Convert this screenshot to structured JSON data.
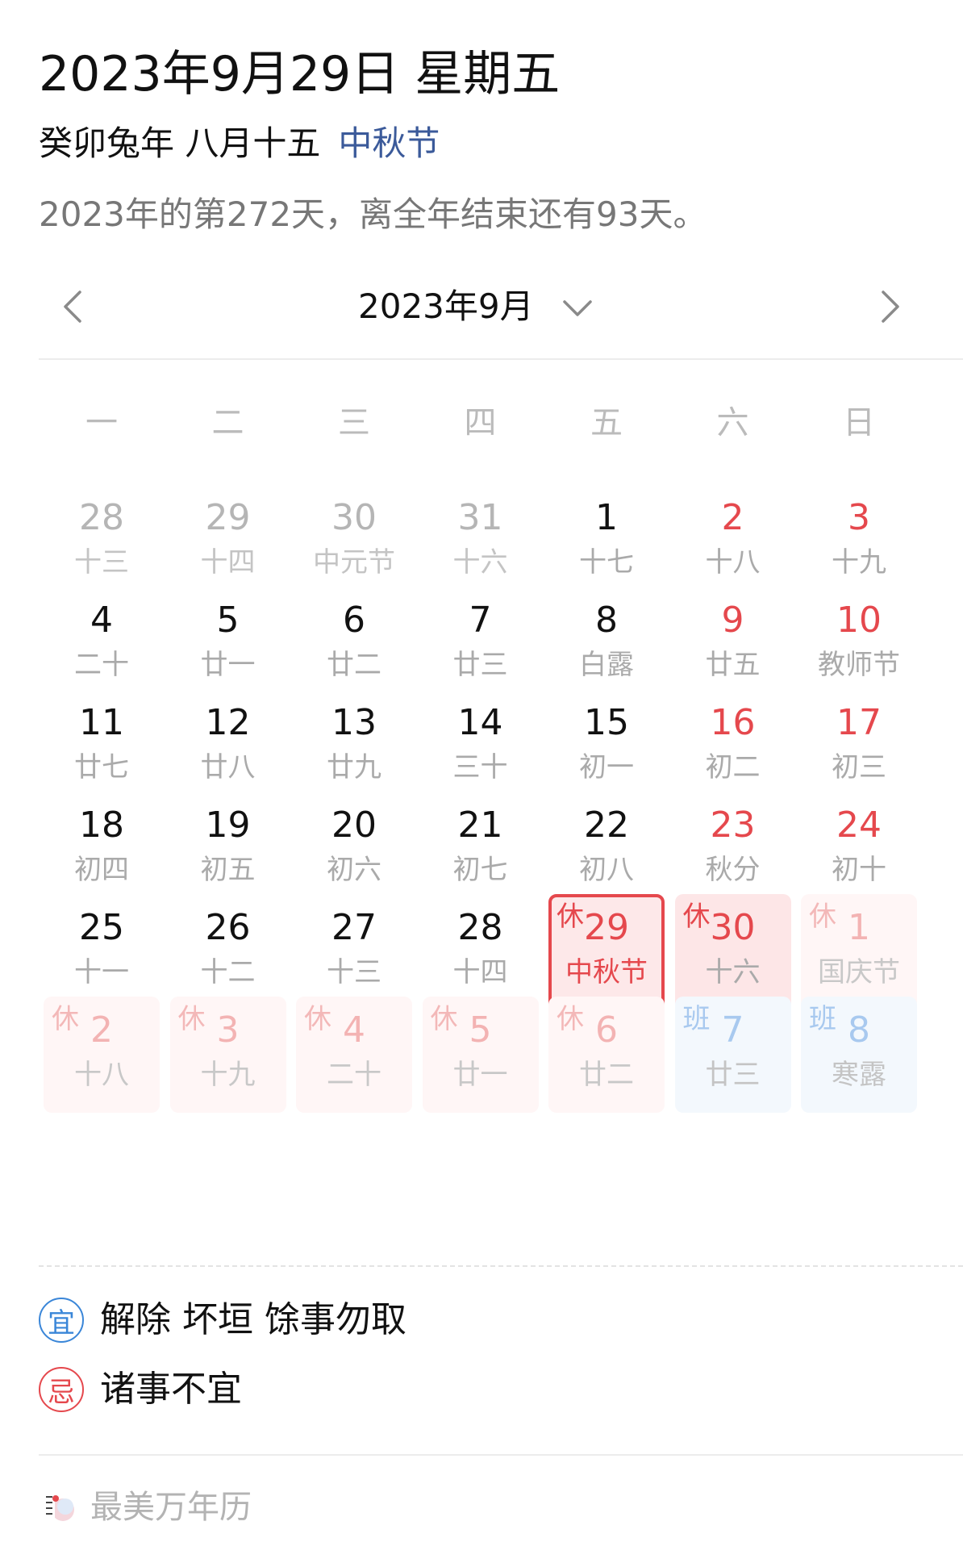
{
  "header": {
    "date_title": "2023年9月29日 星期五",
    "lunar_year": "癸卯兔年 八月十五",
    "festival": "中秋节",
    "year_progress": "2023年的第272天，离全年结束还有93天。"
  },
  "month_nav": {
    "prev_icon": "chevron-left-icon",
    "label": "2023年9月",
    "dropdown_icon": "chevron-down-icon",
    "next_icon": "chevron-right-icon"
  },
  "weekdays": [
    "一",
    "二",
    "三",
    "四",
    "五",
    "六",
    "日"
  ],
  "calendar": {
    "rows": [
      [
        {
          "day": "28",
          "lunar": "十三",
          "type": "other"
        },
        {
          "day": "29",
          "lunar": "十四",
          "type": "other"
        },
        {
          "day": "30",
          "lunar": "中元节",
          "type": "other"
        },
        {
          "day": "31",
          "lunar": "十六",
          "type": "other"
        },
        {
          "day": "1",
          "lunar": "十七",
          "type": "normal"
        },
        {
          "day": "2",
          "lunar": "十八",
          "type": "weekend"
        },
        {
          "day": "3",
          "lunar": "十九",
          "type": "weekend"
        }
      ],
      [
        {
          "day": "4",
          "lunar": "二十",
          "type": "normal"
        },
        {
          "day": "5",
          "lunar": "廿一",
          "type": "normal"
        },
        {
          "day": "6",
          "lunar": "廿二",
          "type": "normal"
        },
        {
          "day": "7",
          "lunar": "廿三",
          "type": "normal"
        },
        {
          "day": "8",
          "lunar": "白露",
          "type": "normal"
        },
        {
          "day": "9",
          "lunar": "廿五",
          "type": "weekend"
        },
        {
          "day": "10",
          "lunar": "教师节",
          "type": "weekend"
        }
      ],
      [
        {
          "day": "11",
          "lunar": "廿七",
          "type": "normal"
        },
        {
          "day": "12",
          "lunar": "廿八",
          "type": "normal"
        },
        {
          "day": "13",
          "lunar": "廿九",
          "type": "normal"
        },
        {
          "day": "14",
          "lunar": "三十",
          "type": "normal"
        },
        {
          "day": "15",
          "lunar": "初一",
          "type": "normal"
        },
        {
          "day": "16",
          "lunar": "初二",
          "type": "weekend"
        },
        {
          "day": "17",
          "lunar": "初三",
          "type": "weekend"
        }
      ],
      [
        {
          "day": "18",
          "lunar": "初四",
          "type": "normal"
        },
        {
          "day": "19",
          "lunar": "初五",
          "type": "normal"
        },
        {
          "day": "20",
          "lunar": "初六",
          "type": "normal"
        },
        {
          "day": "21",
          "lunar": "初七",
          "type": "normal"
        },
        {
          "day": "22",
          "lunar": "初八",
          "type": "normal"
        },
        {
          "day": "23",
          "lunar": "秋分",
          "type": "weekend"
        },
        {
          "day": "24",
          "lunar": "初十",
          "type": "weekend"
        }
      ],
      [
        {
          "day": "25",
          "lunar": "十一",
          "type": "normal"
        },
        {
          "day": "26",
          "lunar": "十二",
          "type": "normal"
        },
        {
          "day": "27",
          "lunar": "十三",
          "type": "normal"
        },
        {
          "day": "28",
          "lunar": "十四",
          "type": "normal"
        },
        {
          "day": "29",
          "lunar": "中秋节",
          "type": "selected",
          "tag": "休"
        },
        {
          "day": "30",
          "lunar": "十六",
          "type": "holiday-current",
          "tag": "休"
        },
        {
          "day": "1",
          "lunar": "国庆节",
          "type": "holiday-other",
          "tag": "休"
        }
      ],
      [
        {
          "day": "2",
          "lunar": "十八",
          "type": "holiday-other",
          "tag": "休"
        },
        {
          "day": "3",
          "lunar": "十九",
          "type": "holiday-other",
          "tag": "休"
        },
        {
          "day": "4",
          "lunar": "二十",
          "type": "holiday-other",
          "tag": "休"
        },
        {
          "day": "5",
          "lunar": "廿一",
          "type": "holiday-other",
          "tag": "休"
        },
        {
          "day": "6",
          "lunar": "廿二",
          "type": "holiday-other",
          "tag": "休"
        },
        {
          "day": "7",
          "lunar": "廿三",
          "type": "workday",
          "tag": "班"
        },
        {
          "day": "8",
          "lunar": "寒露",
          "type": "workday",
          "tag": "班"
        }
      ]
    ]
  },
  "almanac": {
    "yi_label": "宜",
    "yi_text": "解除 坏垣 馀事勿取",
    "ji_label": "忌",
    "ji_text": "诸事不宜"
  },
  "footer": {
    "app_name": "最美万年历",
    "logo_icon": "app-logo-icon"
  },
  "colors": {
    "accent_red": "#e5484d",
    "festival_blue": "#3b5a9a",
    "yi_blue": "#3a86d8",
    "holiday_bg": "#fde6e7",
    "workday_bg": "#f3f8fd"
  }
}
